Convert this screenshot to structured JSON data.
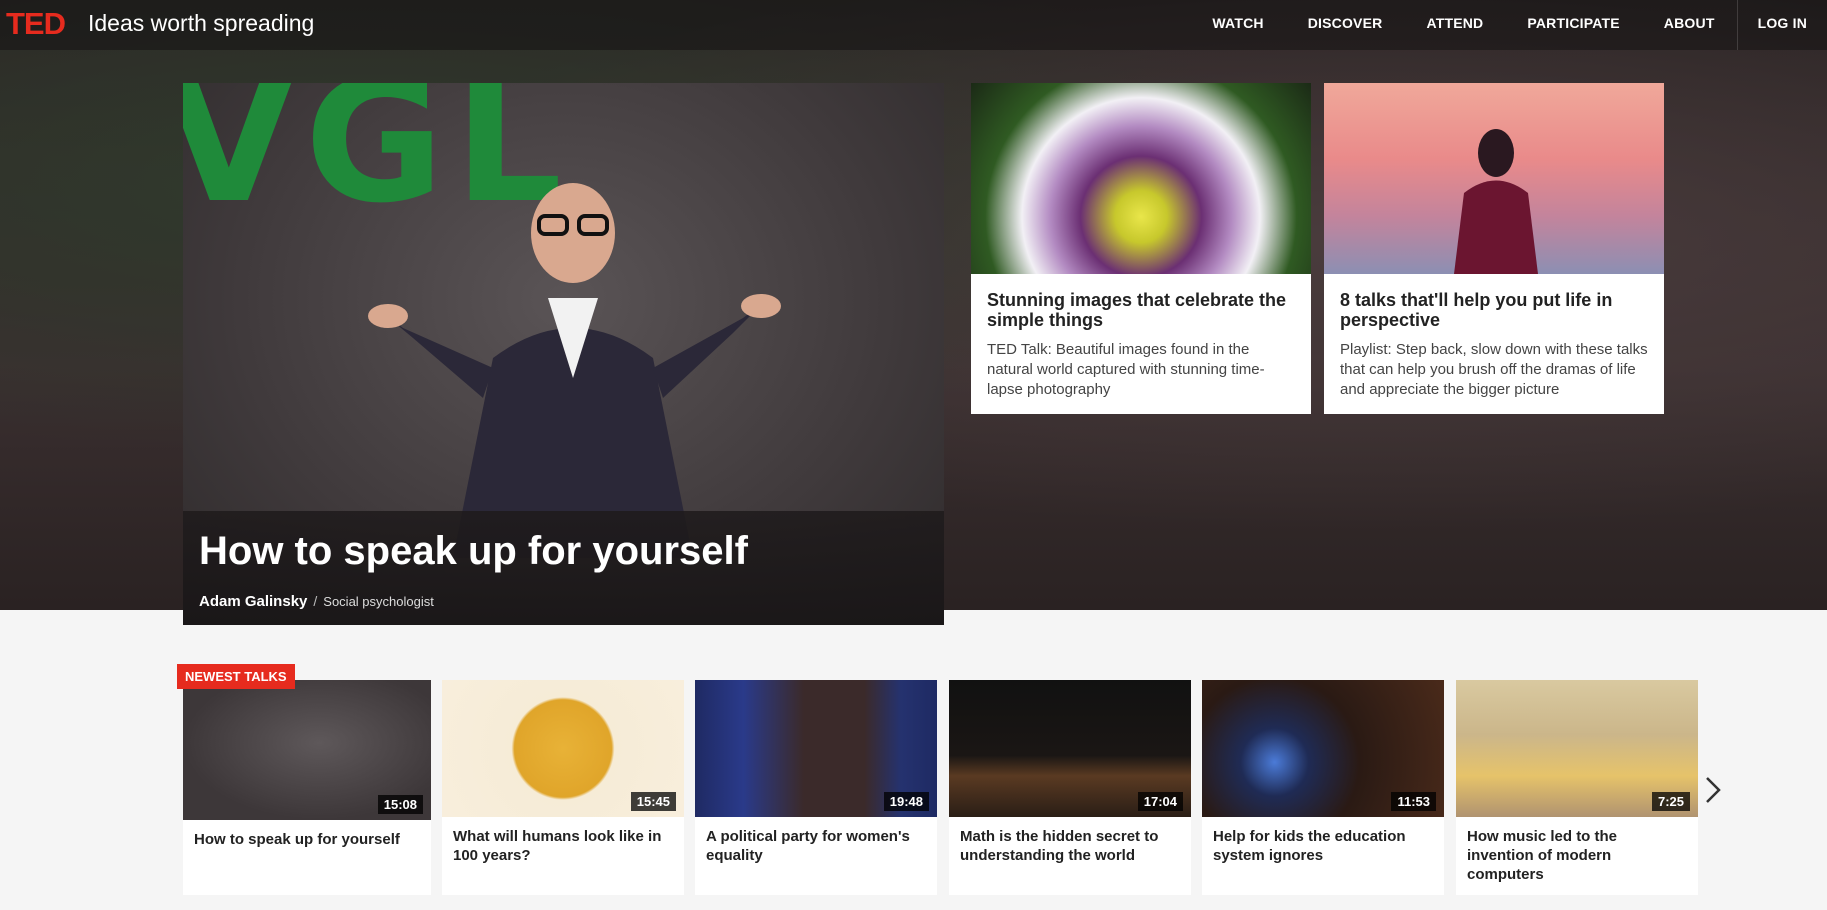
{
  "brand": {
    "logo": "TED",
    "tagline": "Ideas worth spreading",
    "accent": "#e62b1e"
  },
  "nav": {
    "items": [
      "WATCH",
      "DISCOVER",
      "ATTEND",
      "PARTICIPATE",
      "ABOUT"
    ],
    "login": "LOG IN"
  },
  "feature": {
    "title": "How to speak up for yourself",
    "speaker": "Adam Galinsky",
    "separator": "/",
    "role": "Social psychologist"
  },
  "cards": [
    {
      "title": "Stunning images that celebrate the simple things",
      "description": "TED Talk: Beautiful images found in the natural world captured with stunning time-lapse photography",
      "image": "flower-photo"
    },
    {
      "title": "8 talks that'll help you put life in perspective",
      "description": "Playlist: Step back, slow down with these talks that can help you brush off the dramas of life and appreciate the bigger picture",
      "image": "person-by-water-photo"
    }
  ],
  "newest": {
    "badge": "NEWEST TALKS",
    "talks": [
      {
        "title": "How to speak up for yourself",
        "duration": "15:08"
      },
      {
        "title": "What will humans look like in 100 years?",
        "duration": "15:45"
      },
      {
        "title": "A political party for women's equality",
        "duration": "19:48"
      },
      {
        "title": "Math is the hidden secret to understanding the world",
        "duration": "17:04"
      },
      {
        "title": "Help for kids the education system ignores",
        "duration": "11:53"
      },
      {
        "title": "How music led to the invention of modern computers",
        "duration": "7:25"
      }
    ]
  },
  "icons": {
    "next": "chevron-right-icon"
  }
}
